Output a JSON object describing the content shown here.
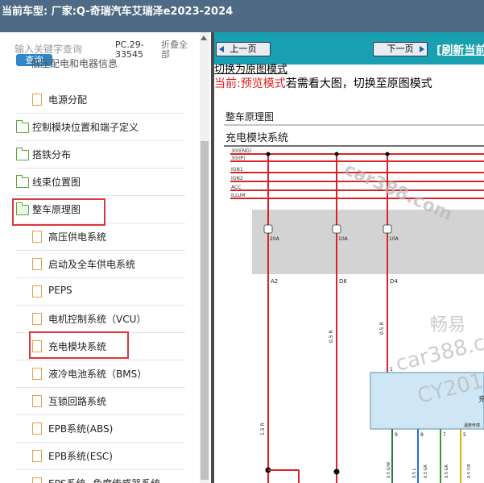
{
  "titlebar": {
    "title": "当前车型:  厂家:Q-奇瑞汽车艾瑞泽e2023-2024"
  },
  "sidebar": {
    "search_placeholder": "输入关键字查询",
    "search_button": "查询",
    "code": "PC.29-33545",
    "collapse_all": "折叠全部",
    "partial_top_label": "低压配电和电器信息",
    "items": [
      {
        "label": "电源分配",
        "type": "file"
      },
      {
        "label": "控制模块位置和端子定义",
        "type": "folder"
      },
      {
        "label": "搭铁分布",
        "type": "folder"
      },
      {
        "label": "线束位置图",
        "type": "folder"
      },
      {
        "label": "整车原理图",
        "type": "folder-open",
        "highlighted": true
      },
      {
        "label": "高压供电系统",
        "type": "file"
      },
      {
        "label": "启动及全车供电系统",
        "type": "file"
      },
      {
        "label": "PEPS",
        "type": "file"
      },
      {
        "label": "电机控制系统（VCU）",
        "type": "file"
      },
      {
        "label": "充电模块系统",
        "type": "file",
        "highlighted": true
      },
      {
        "label": "液冷电池系统（BMS）",
        "type": "file"
      },
      {
        "label": "互锁回路系统",
        "type": "file"
      },
      {
        "label": "EPB系统(ABS)",
        "type": "file"
      },
      {
        "label": "EPB系统(ESC)",
        "type": "file"
      },
      {
        "label": "EPS系统--角度传感器系统",
        "type": "file"
      }
    ]
  },
  "viewer": {
    "prev_page": "上一页",
    "next_page": "下一页",
    "refresh": "[刷新当前",
    "switch_link": "切换为原图模式",
    "mode_current_label": "当前:",
    "mode_value": "预览模式",
    "mode_hint": "若需看大图，切换至原图模式"
  },
  "diagram": {
    "heading": "整车原理图",
    "subheading": "充电模块系统",
    "power_lines": [
      "30(ENG)",
      "30(IP)",
      "IGN1",
      "IGN2",
      "ACC",
      "ILLUM"
    ],
    "fuses": [
      "20A",
      "10A",
      "10A"
    ],
    "connectors": [
      "A2",
      "D6",
      "D4"
    ],
    "wire_colors": [
      "1.5 R",
      "0.5 R",
      "0.5 R"
    ],
    "module_label": "充",
    "module_sub": "温度传感",
    "pin_numbers": [
      "9",
      "8",
      "7",
      "5"
    ],
    "bottom_wires": [
      "0.5 G/W",
      "0.5 L",
      "0.5 GR",
      "0.5 GR",
      "0.5 Y/R"
    ],
    "watermark_1": "car388.com",
    "watermark_2": "畅易",
    "watermark_3": "car388.c",
    "watermark_4": "CY201"
  },
  "colors": {
    "titlebar": "#4e6a84",
    "navbar": "#19a0b0",
    "highlight": "#d9363e",
    "folder": "#5aa63b",
    "file": "#e1a04a",
    "wire_red": "#d8232a"
  }
}
